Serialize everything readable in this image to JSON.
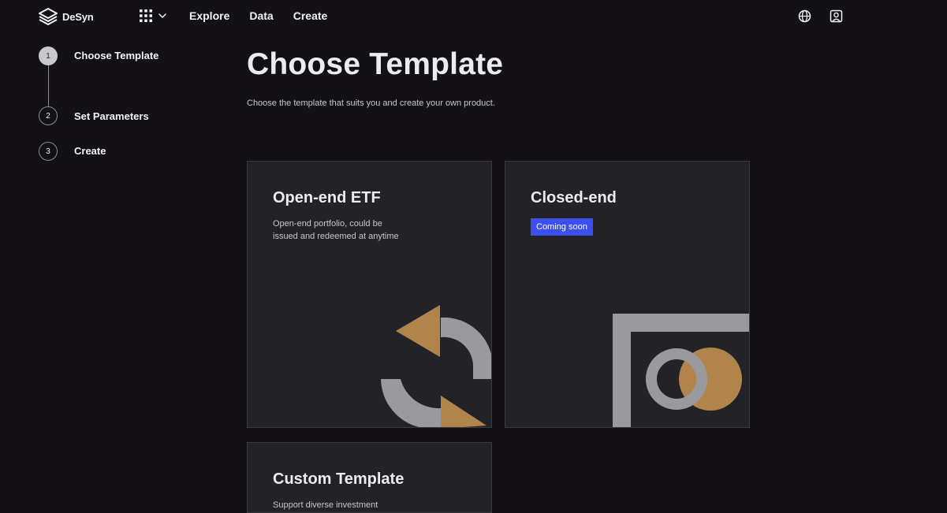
{
  "brand": {
    "name": "DeSyn"
  },
  "nav": {
    "items": [
      "Explore",
      "Data",
      "Create"
    ]
  },
  "stepper": {
    "steps": [
      {
        "number": "1",
        "label": "Choose Template",
        "active": true
      },
      {
        "number": "2",
        "label": "Set Parameters",
        "active": false
      },
      {
        "number": "3",
        "label": "Create",
        "active": false
      }
    ]
  },
  "page": {
    "title": "Choose Template",
    "subtitle": "Choose the template that suits you and create your own product."
  },
  "cards": {
    "open_end": {
      "title": "Open-end ETF",
      "description": "Open-end portfolio, could be issued and redeemed at anytime"
    },
    "closed_end": {
      "title": "Closed-end",
      "badge": "Coming soon"
    },
    "custom": {
      "title": "Custom Template",
      "description": "Support diverse investment"
    }
  },
  "colors": {
    "background": "#131115",
    "card": "#232227",
    "accent_gold": "#b0844a",
    "shape_gray": "#9a9a9e",
    "badge_blue": "#3b4ef0"
  },
  "icons": {
    "logo": "stacked-layers-icon",
    "apps": "grid-icon",
    "apps_chevron": "chevron-down-icon",
    "language": "globe-icon",
    "account": "user-icon"
  }
}
